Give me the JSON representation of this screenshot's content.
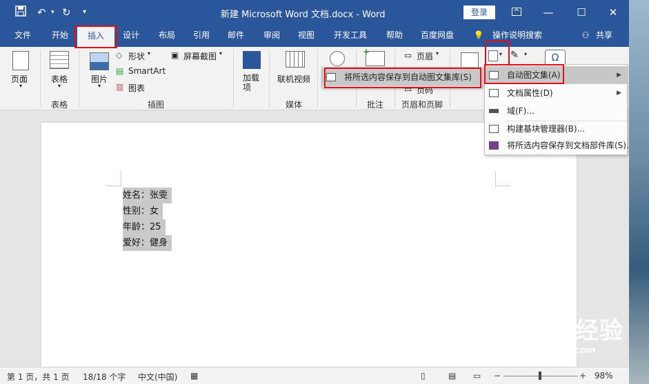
{
  "window": {
    "title": "新建 Microsoft Word 文档.docx  -  Word",
    "login_label": "登录",
    "share_label": "共享",
    "tell_me": "操作说明搜索"
  },
  "tabs": [
    {
      "label": "文件"
    },
    {
      "label": "开始"
    },
    {
      "label": "插入"
    },
    {
      "label": "设计"
    },
    {
      "label": "布局"
    },
    {
      "label": "引用"
    },
    {
      "label": "邮件"
    },
    {
      "label": "审阅"
    },
    {
      "label": "视图"
    },
    {
      "label": "开发工具"
    },
    {
      "label": "帮助"
    },
    {
      "label": "百度网盘"
    }
  ],
  "ribbon": {
    "page": "页面",
    "table": "表格",
    "picture": "图片",
    "shapes": "形状",
    "smartart": "SmartArt",
    "chart": "图表",
    "screenshot": "屏幕截图",
    "addins": "加载项",
    "online_video": "联机视频",
    "header": "页眉",
    "page_number": "页码",
    "groups": {
      "table": "表格",
      "illustrations": "插图",
      "media": "媒体",
      "comments": "批注",
      "header_footer": "页眉和页脚"
    }
  },
  "autotext_submenu": {
    "save_selection": "将所选内容保存到自动图文集库(S)"
  },
  "quickparts_menu": {
    "items": [
      {
        "label": "自动图文集(A)"
      },
      {
        "label": "文档属性(D)"
      },
      {
        "label": "域(F)..."
      },
      {
        "label": "构建基块管理器(B)..."
      },
      {
        "label": "将所选内容保存到文档部件库(S)..."
      }
    ]
  },
  "document": {
    "lines": [
      "姓名：张雯",
      "性别：女",
      "年龄：25",
      "爱好：健身"
    ]
  },
  "status": {
    "page": "第 1 页，共 1 页",
    "words": "18/18 个字",
    "language": "中文(中国)",
    "zoom": "98%"
  },
  "watermark": {
    "brand": "Baidu经验",
    "url": "jingyan.baidu.com"
  },
  "colors": {
    "accent": "#2b579a",
    "highlight_red": "#e0101a"
  }
}
